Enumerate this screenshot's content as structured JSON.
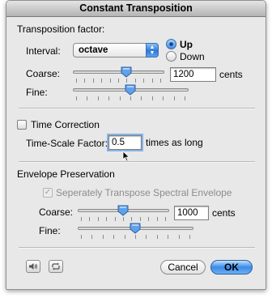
{
  "window": {
    "title": "Constant Transposition"
  },
  "transposition": {
    "heading": "Transposition factor:",
    "interval_label": "Interval:",
    "interval_value": "octave",
    "radio_up": "Up",
    "radio_down": "Down",
    "selected_direction": "Up",
    "coarse_label": "Coarse:",
    "coarse_value": "1200",
    "coarse_unit": "cents",
    "coarse_level": 0.6,
    "fine_label": "Fine:",
    "fine_level": 0.5
  },
  "time_correction": {
    "checkbox_label": "Time Correction",
    "checked": false,
    "factor_label": "Time-Scale Factor:",
    "factor_value": "0.5",
    "factor_suffix": "times as long"
  },
  "envelope": {
    "heading": "Envelope Preservation",
    "checkbox_label": "Seperately Transpose Spectral Envelope",
    "checked": true,
    "enabled": false,
    "coarse_label": "Coarse:",
    "coarse_value": "1000",
    "coarse_unit": "cents",
    "coarse_level": 0.5,
    "fine_label": "Fine:",
    "fine_level": 0.5
  },
  "footer": {
    "speaker_icon": "speaker-icon",
    "loop_icon": "loop-icon",
    "cancel_label": "Cancel",
    "ok_label": "OK"
  },
  "colors": {
    "accent": "#3b8ae6",
    "window_bg": "#e8e8e8"
  }
}
